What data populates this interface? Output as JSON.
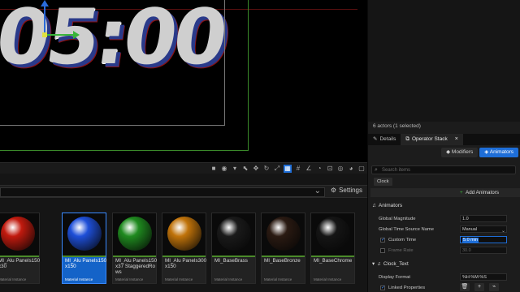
{
  "viewport": {
    "clock_text": "05:00"
  },
  "content_browser": {
    "settings_label": "Settings",
    "assets": [
      {
        "name": "MI_Alu Panels150x30",
        "kind": "Material Instance",
        "color": "#c11a0e",
        "selected": false
      },
      {
        "name": "MI_Alu Panels150x150",
        "kind": "Material Instance",
        "color": "#1e4fd8",
        "selected": true
      },
      {
        "name": "MI_Alu Panels150x37 StaggeredRows",
        "kind": "Material Instance",
        "color": "#1f8a1f",
        "selected": false
      },
      {
        "name": "MI_Alu Panels300x150",
        "kind": "Material Instance",
        "color": "#c0730a",
        "selected": false
      },
      {
        "name": "MI_BaseBrass",
        "kind": "Material Instance",
        "color": "#1a1a1a",
        "selected": false
      },
      {
        "name": "MI_BaseBronze",
        "kind": "Material Instance",
        "color": "#2a1a12",
        "selected": false
      },
      {
        "name": "MI_BaseChrome",
        "kind": "Material Instance",
        "color": "#151515",
        "selected": false
      }
    ]
  },
  "panel": {
    "actors_count": "6 actors (1 selected)",
    "tabs": {
      "details": "Details",
      "operator_stack": "Operator Stack"
    },
    "subtabs": {
      "modifiers": "Modifiers",
      "animators": "Animators"
    },
    "search_placeholder": "Search items",
    "clock_chip": "Clock",
    "add_animators": "Add Animators",
    "animators_section": "Animators",
    "properties": {
      "global_magnitude": {
        "label": "Global Magnitude",
        "value": "1.0"
      },
      "global_time_source": {
        "label": "Global Time Source Name",
        "value": "Manual"
      },
      "custom_time": {
        "label": "Custom Time",
        "value": "5.0 min"
      },
      "frame_rate": {
        "label": "Frame Rate",
        "value": "30.0"
      }
    },
    "clock_text_section": "Clock_Text",
    "display_format": {
      "label": "Display Format",
      "value": "%H:%M:%S"
    },
    "linked_properties": {
      "label": "Linked Properties"
    }
  }
}
